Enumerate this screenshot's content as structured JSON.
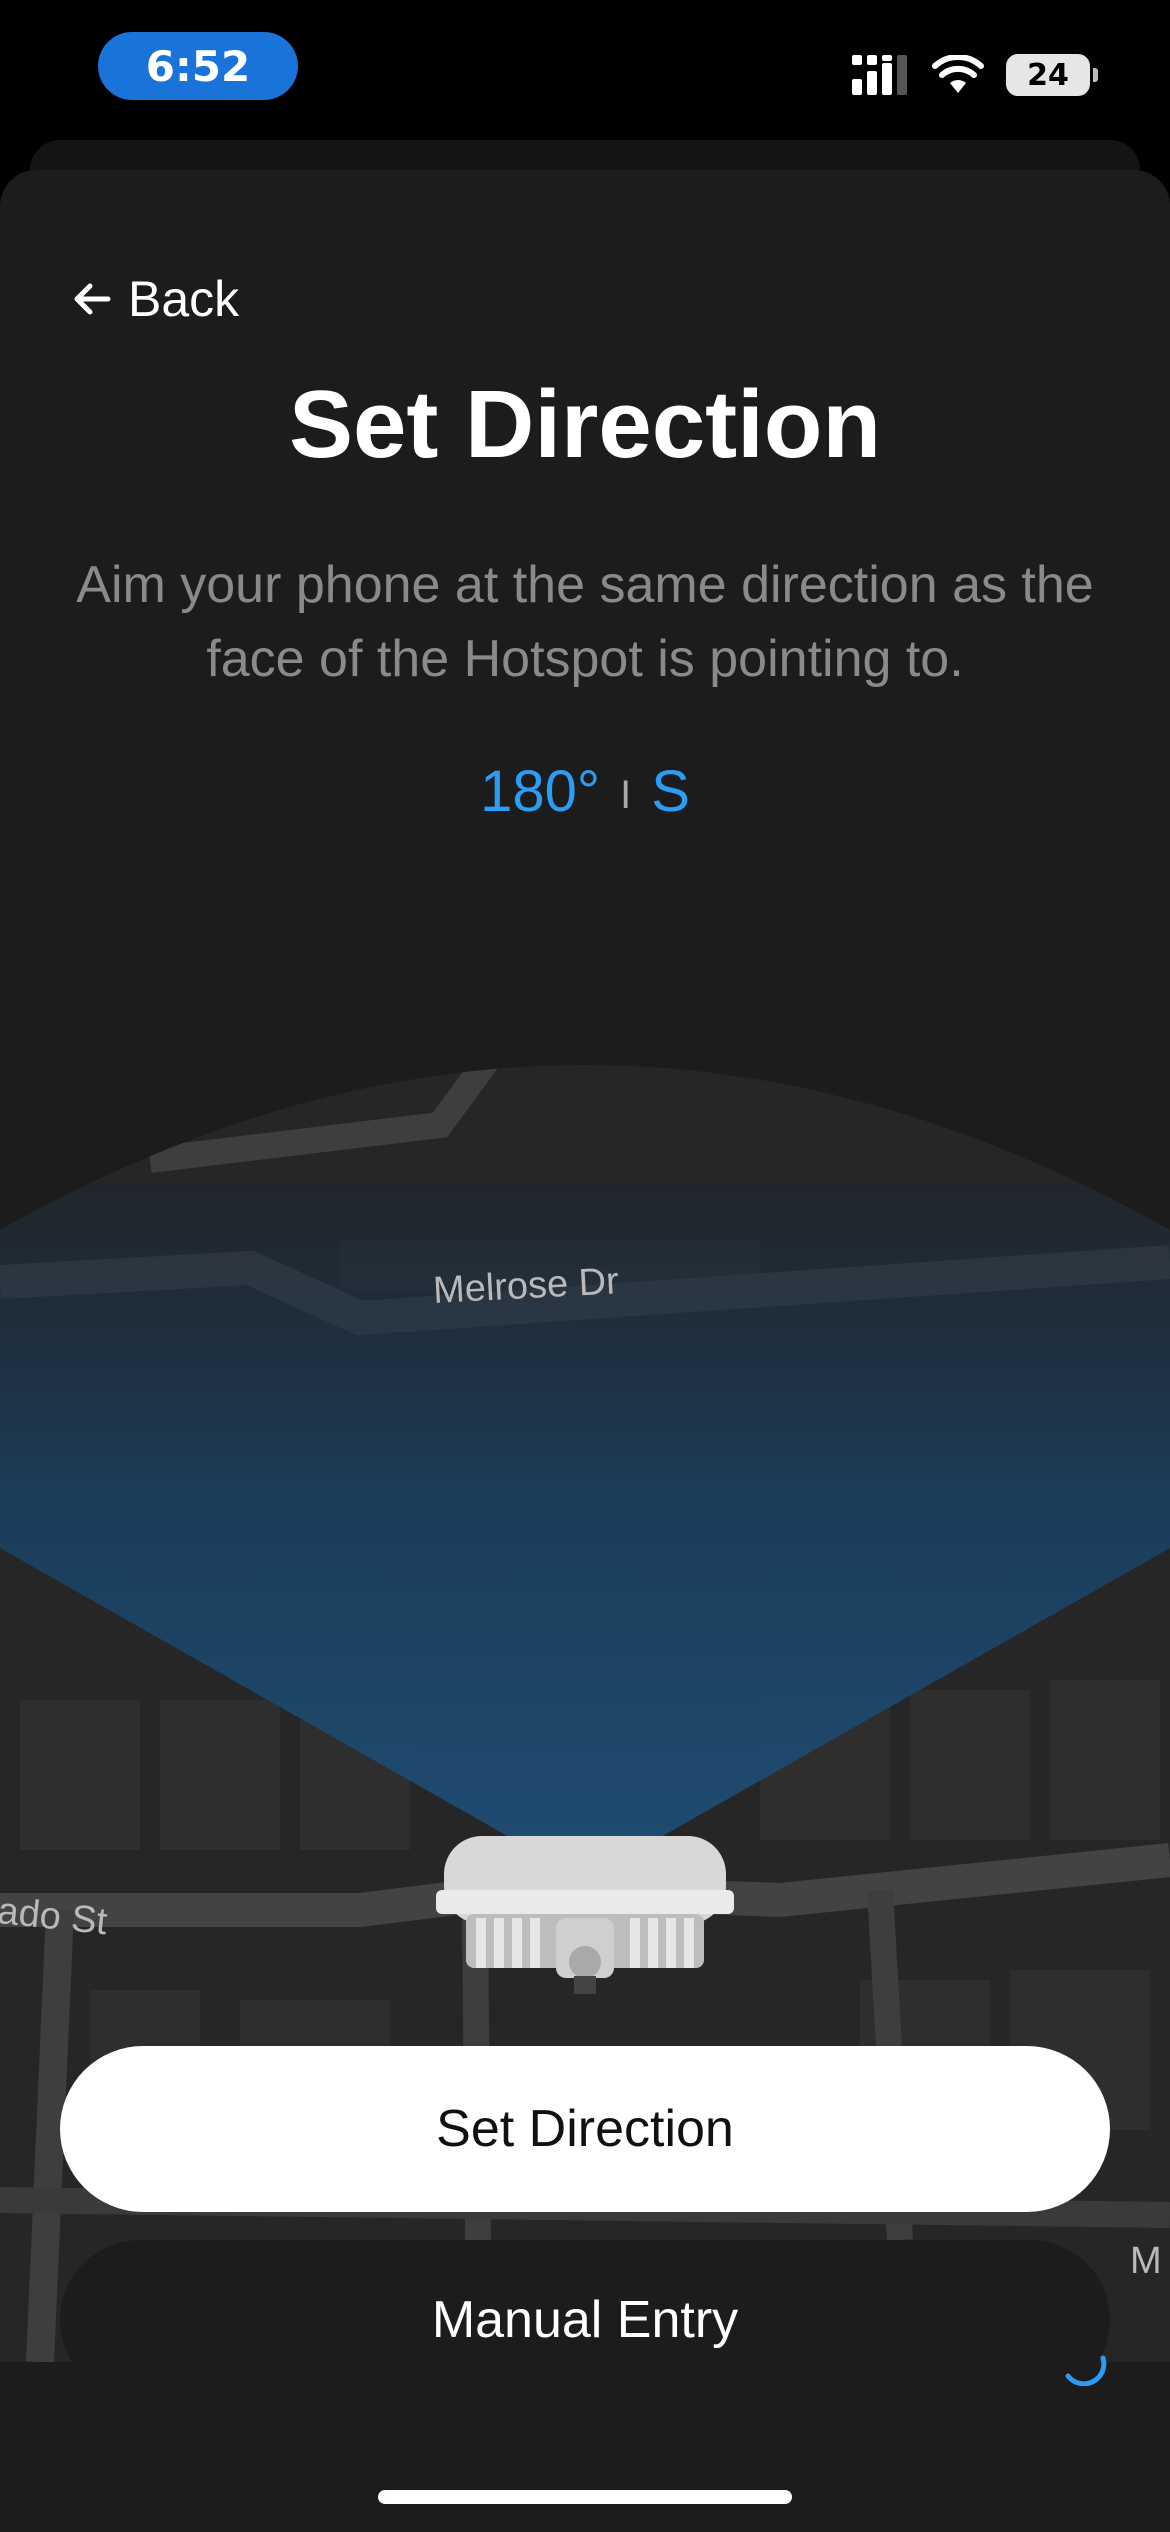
{
  "status_bar": {
    "time": "6:52",
    "battery": "24"
  },
  "nav": {
    "back_label": "Back"
  },
  "header": {
    "title": "Set Direction",
    "subtitle": "Aim your phone at the same direction as the face of the Hotspot is pointing to."
  },
  "heading_readout": {
    "degrees": "180°",
    "separator": "I",
    "cardinal": "S"
  },
  "map": {
    "street_1": "Melrose Dr",
    "street_2": "ado St",
    "street_3": "M"
  },
  "actions": {
    "primary_label": "Set Direction",
    "secondary_label": "Manual Entry"
  },
  "colors": {
    "accent": "#2a9df4",
    "background": "#1c1c1c",
    "cone": "#1e4f78"
  },
  "icons": [
    "cellular-signal-icon",
    "wifi-icon",
    "battery-icon",
    "arrow-left-icon",
    "hotspot-device-icon",
    "loading-spinner-icon"
  ]
}
